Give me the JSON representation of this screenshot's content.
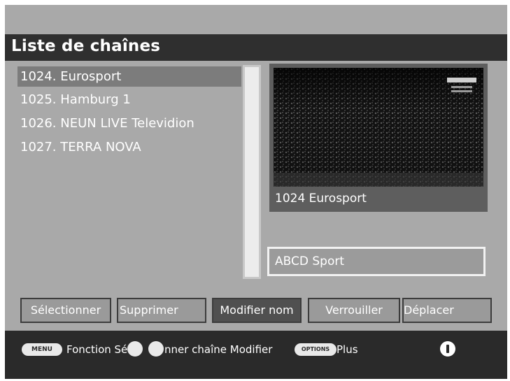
{
  "header": {
    "title": "Liste de chaînes"
  },
  "channels": [
    {
      "label": "1024. Eurosport",
      "selected": true
    },
    {
      "label": "1025. Hamburg 1",
      "selected": false
    },
    {
      "label": "1026. NEUN LIVE Televidion",
      "selected": false
    },
    {
      "label": "1027. TERRA NOVA",
      "selected": false
    }
  ],
  "preview": {
    "caption": "1024 Eurosport",
    "icon": "tv-preview"
  },
  "name_field": {
    "value": "ABCD Sport"
  },
  "buttons": {
    "select": "Sélectionner",
    "delete": "Supprimer",
    "rename": "Modifier nom",
    "lock": "Verrouiller",
    "move": "Déplacer"
  },
  "footer": {
    "menu_key": "MENU",
    "hint_1": "Fonction Séle",
    "hint_2": "nner chaîne Modifier",
    "second_key": "OPTIONS",
    "hint_3": "Plus",
    "info_icon": "info-icon"
  },
  "colors": {
    "background": "#a9a9a9",
    "title_bar": "#2f2f2f",
    "selected_row": "#7c7c7c",
    "footer": "#2a2a2a"
  }
}
